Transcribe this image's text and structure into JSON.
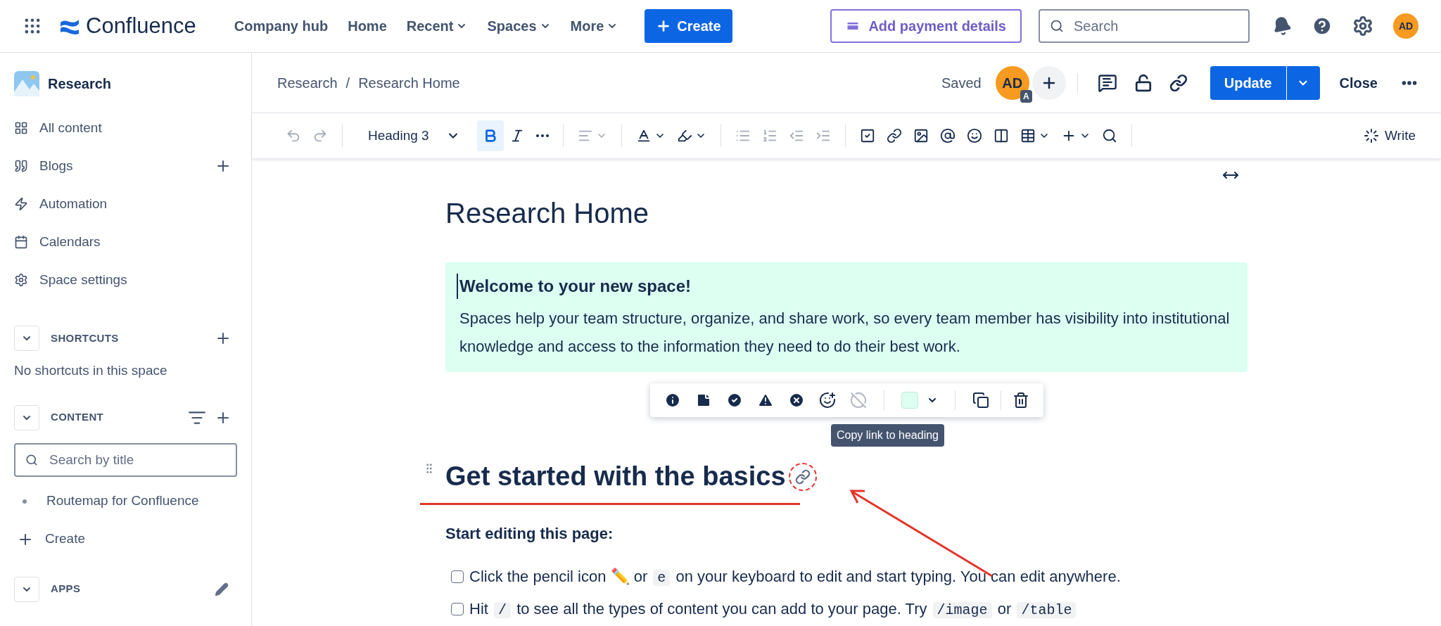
{
  "top_nav": {
    "logo": "Confluence",
    "links": [
      {
        "label": "Company hub",
        "dropdown": false
      },
      {
        "label": "Home",
        "dropdown": false
      },
      {
        "label": "Recent",
        "dropdown": true
      },
      {
        "label": "Spaces",
        "dropdown": true
      },
      {
        "label": "More",
        "dropdown": true
      }
    ],
    "create": "Create",
    "payment": "Add payment details",
    "search": {
      "placeholder": "Search"
    },
    "avatar": "AD"
  },
  "sidebar": {
    "space": "Research",
    "items": [
      {
        "label": "All content",
        "kind": "grid",
        "add": false
      },
      {
        "label": "Blogs",
        "kind": "quote",
        "add": true
      },
      {
        "label": "Automation",
        "kind": "bolt",
        "add": false
      },
      {
        "label": "Calendars",
        "kind": "calendar",
        "add": false
      },
      {
        "label": "Space settings",
        "kind": "gear",
        "add": false
      }
    ],
    "shortcuts": {
      "title": "SHORTCUTS",
      "empty": "No shortcuts in this space"
    },
    "content": {
      "title": "CONTENT",
      "search": {
        "placeholder": "Search by title"
      },
      "tree": [
        {
          "label": "Routemap for Confluence"
        }
      ],
      "create": "Create"
    },
    "apps": {
      "title": "APPS"
    }
  },
  "page_header": {
    "breadcrumbs": [
      "Research",
      "Research Home"
    ],
    "breadcrumb_separator": "/",
    "status": "Saved",
    "collaborator": "AD",
    "collaborator_badge": "A",
    "update": "Update",
    "close": "Close"
  },
  "toolbar": {
    "heading_style": "Heading 3",
    "write": "Write",
    "items": [
      {
        "kind": "undo",
        "disabled": true
      },
      {
        "kind": "redo",
        "disabled": true
      },
      {
        "kind": "style"
      },
      {
        "kind": "bold",
        "disabled": false,
        "pressed": true
      },
      {
        "kind": "italic",
        "disabled": false,
        "pressed": false
      },
      {
        "kind": "more",
        "disabled": false
      },
      {
        "kind": "align",
        "disabled": true
      },
      {
        "kind": "textcolor",
        "disabled": false
      },
      {
        "kind": "highlight",
        "disabled": false
      },
      {
        "kind": "bullets",
        "disabled": true
      },
      {
        "kind": "numbers",
        "disabled": true
      },
      {
        "kind": "outdent",
        "disabled": true
      },
      {
        "kind": "indent",
        "disabled": true
      },
      {
        "kind": "task",
        "disabled": false
      },
      {
        "kind": "link",
        "disabled": false
      },
      {
        "kind": "image",
        "disabled": false
      },
      {
        "kind": "mention",
        "disabled": false
      },
      {
        "kind": "emoji",
        "disabled": false
      },
      {
        "kind": "layout",
        "disabled": false
      },
      {
        "kind": "table",
        "disabled": false
      },
      {
        "kind": "insert",
        "disabled": false
      },
      {
        "kind": "find",
        "disabled": false
      },
      {
        "kind": "write"
      }
    ]
  },
  "content": {
    "title": "Research Home",
    "panel": {
      "title": "Welcome to your new space!",
      "body": "Spaces help your team structure, organize, and share work, so every team member has visibility into institutional knowledge and access to the information they need to do their best work."
    },
    "panel_toolbar": [
      {
        "kind": "info",
        "disabled": false
      },
      {
        "kind": "note",
        "disabled": false
      },
      {
        "kind": "success",
        "disabled": false
      },
      {
        "kind": "warning",
        "disabled": false
      },
      {
        "kind": "error",
        "disabled": false
      },
      {
        "kind": "custom",
        "disabled": false
      },
      {
        "kind": "noemoji",
        "disabled": true
      },
      {
        "kind": "swatch",
        "disabled": false
      },
      {
        "kind": "copy",
        "disabled": false
      },
      {
        "kind": "delete",
        "disabled": false
      }
    ],
    "tooltip": "Copy link to heading",
    "heading": "Get started with the basics",
    "subheading": "Start editing this page:",
    "tasks": [
      {
        "checked": false,
        "parts": [
          {
            "kind": "text",
            "text": "Click the pencil icon ✏️ or "
          },
          {
            "kind": "code",
            "text": "e"
          },
          {
            "kind": "text",
            "text": " on your keyboard to edit and start typing. You can edit anywhere."
          }
        ]
      },
      {
        "checked": false,
        "parts": [
          {
            "kind": "text",
            "text": "Hit "
          },
          {
            "kind": "code",
            "text": "/"
          },
          {
            "kind": "text",
            "text": " to see all the types of content you can add to your page. Try "
          },
          {
            "kind": "code",
            "text": "/image"
          },
          {
            "kind": "text",
            "text": " or "
          },
          {
            "kind": "code",
            "text": "/table"
          }
        ]
      }
    ]
  }
}
